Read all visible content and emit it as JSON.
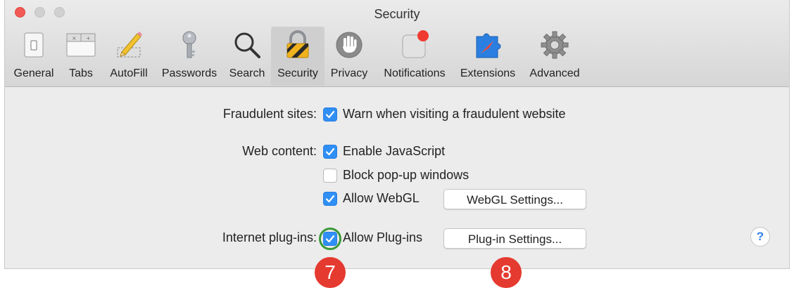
{
  "window": {
    "title": "Security"
  },
  "toolbar": {
    "items": [
      {
        "label": "General",
        "icon": "general-icon"
      },
      {
        "label": "Tabs",
        "icon": "tabs-icon"
      },
      {
        "label": "AutoFill",
        "icon": "autofill-pencil-icon"
      },
      {
        "label": "Passwords",
        "icon": "key-icon"
      },
      {
        "label": "Search",
        "icon": "magnifier-icon"
      },
      {
        "label": "Security",
        "icon": "padlock-icon",
        "selected": true
      },
      {
        "label": "Privacy",
        "icon": "hand-icon"
      },
      {
        "label": "Notifications",
        "icon": "notification-badge-icon"
      },
      {
        "label": "Extensions",
        "icon": "puzzle-compass-icon"
      },
      {
        "label": "Advanced",
        "icon": "gear-icon"
      }
    ]
  },
  "settings": {
    "fraudulent": {
      "label": "Fraudulent sites:",
      "option": "Warn when visiting a fraudulent website",
      "checked": true
    },
    "web_content": {
      "label": "Web content:",
      "javascript": "Enable JavaScript",
      "javascript_checked": true,
      "popups": "Block pop-up windows",
      "popups_checked": false,
      "webgl": "Allow WebGL",
      "webgl_checked": true,
      "webgl_button": "WebGL Settings..."
    },
    "plugins": {
      "label": "Internet plug-ins:",
      "option": "Allow Plug-ins",
      "checked": true,
      "button": "Plug-in Settings..."
    },
    "help": "?"
  },
  "annotations": {
    "callout_7": "7",
    "callout_8": "8"
  },
  "colors": {
    "accent": "#2f8ff5",
    "callout": "#e53a30",
    "focus_ring": "#3a9a3a",
    "close": "#f25a55"
  }
}
